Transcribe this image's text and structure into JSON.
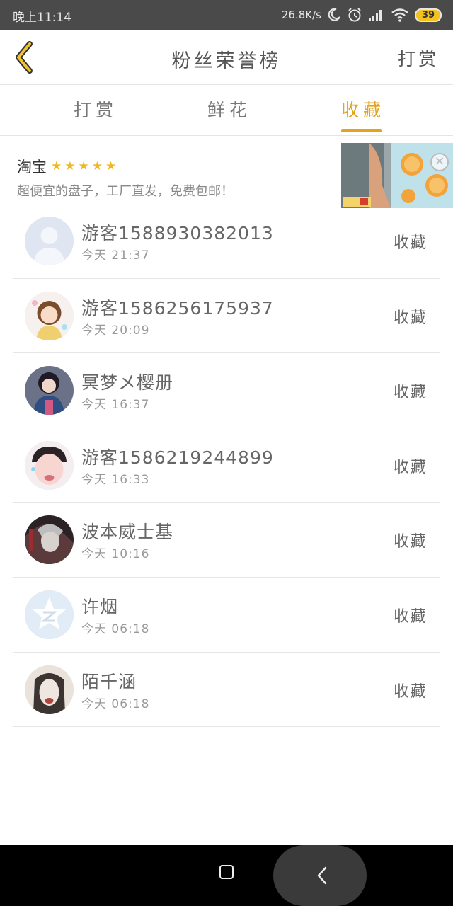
{
  "status_bar": {
    "time": "晚上11:14",
    "net_speed": "26.8K/s",
    "battery": "39"
  },
  "header": {
    "back_icon": "chevron-left-icon",
    "title": "粉丝荣誉榜",
    "action": "打赏"
  },
  "tabs": [
    {
      "label": "打赏",
      "active": false
    },
    {
      "label": "鲜花",
      "active": false
    },
    {
      "label": "收藏",
      "active": true
    }
  ],
  "accent_color": "#e5a21b",
  "ad": {
    "brand": "淘宝",
    "stars": "★★★★★",
    "description": "超便宜的盘子，工厂直发，免费包邮！",
    "close_icon": "close-icon"
  },
  "entries": [
    {
      "name": "游客1588930382013",
      "time": "今天 21:37",
      "action": "收藏"
    },
    {
      "name": "游客1586256175937",
      "time": "今天 20:09",
      "action": "收藏"
    },
    {
      "name": "冥梦メ樱册",
      "time": "今天 16:37",
      "action": "收藏"
    },
    {
      "name": "游客1586219244899",
      "time": "今天 16:33",
      "action": "收藏"
    },
    {
      "name": "波本威士基",
      "time": "今天 10:16",
      "action": "收藏"
    },
    {
      "name": "许烟",
      "time": "今天 06:18",
      "action": "收藏"
    },
    {
      "name": "陌千涵",
      "time": "今天 06:18",
      "action": "收藏"
    }
  ]
}
